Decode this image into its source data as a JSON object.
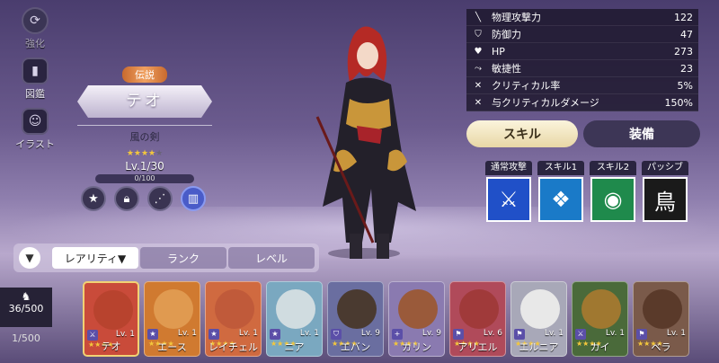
{
  "rail": [
    {
      "label": "強化",
      "icon": "upgrade-icon",
      "disabled": true
    },
    {
      "label": "図鑑",
      "icon": "book-icon",
      "disabled": false
    },
    {
      "label": "イラスト",
      "icon": "portrait-icon",
      "disabled": false
    }
  ],
  "character": {
    "rarity": "伝説",
    "name": "テオ",
    "weapon": "風の剣",
    "level": "Lv.1/30",
    "exp": "0/100",
    "stars_filled": 4
  },
  "stats": [
    {
      "name": "物理攻撃力",
      "value": "122",
      "icon": "sword-icon"
    },
    {
      "name": "防御力",
      "value": "47",
      "icon": "shield-icon"
    },
    {
      "name": "HP",
      "value": "273",
      "icon": "heart-icon"
    },
    {
      "name": "敏捷性",
      "value": "23",
      "icon": "boot-icon"
    },
    {
      "name": "クリティカル率",
      "value": "5%",
      "icon": "crit-icon"
    },
    {
      "name": "与クリティカルダメージ",
      "value": "150%",
      "icon": "crit-damage-icon"
    }
  ],
  "tabs": {
    "skill": "スキル",
    "equip": "装備"
  },
  "skills": [
    {
      "label": "通常攻撃",
      "icon": "normal-attack-icon",
      "bg": "#2050c8",
      "glyph": "⚔"
    },
    {
      "label": "スキル1",
      "icon": "skill1-icon",
      "bg": "#1a7ac8",
      "glyph": "❖"
    },
    {
      "label": "スキル2",
      "icon": "skill2-icon",
      "bg": "#1f8a4c",
      "glyph": "◉"
    },
    {
      "label": "パッシブ",
      "icon": "passive-icon",
      "bg": "#1a1a1a",
      "glyph": "鳥"
    }
  ],
  "sort_tabs": [
    "レアリティ▼",
    "ランク",
    "レベル"
  ],
  "counts": {
    "owned": "36/500",
    "second": "1/500"
  },
  "roster": [
    {
      "name": "テオ",
      "level": "Lv. 1",
      "bg": "#c94b3a",
      "face": "#b8432e",
      "stars": 4,
      "selected": true
    },
    {
      "name": "エース",
      "level": "Lv. 1",
      "bg": "#d07a30",
      "face": "#e09a50",
      "stars": 4,
      "selected": false
    },
    {
      "name": "レイチェル",
      "level": "Lv. 1",
      "bg": "#d06a40",
      "face": "#c05a3a",
      "stars": 4,
      "selected": false
    },
    {
      "name": "ニア",
      "level": "Lv. 1",
      "bg": "#7aa8c0",
      "face": "#d0dce0",
      "stars": 4,
      "selected": false
    },
    {
      "name": "エバン",
      "level": "Lv. 9",
      "bg": "#6a6ea0",
      "face": "#4a3a30",
      "stars": 4,
      "selected": false
    },
    {
      "name": "カリン",
      "level": "Lv. 9",
      "bg": "#8a7ab0",
      "face": "#9a5a3a",
      "stars": 4,
      "selected": false
    },
    {
      "name": "アリエル",
      "level": "Lv. 6",
      "bg": "#b04a5a",
      "face": "#a03a3a",
      "stars": 4,
      "selected": false
    },
    {
      "name": "エルニア",
      "level": "Lv. 1",
      "bg": "#a8a8b8",
      "face": "#e8e8e8",
      "stars": 4,
      "selected": false
    },
    {
      "name": "カイ",
      "level": "Lv. 1",
      "bg": "#4a6a3a",
      "face": "#a07830",
      "stars": 4,
      "selected": false
    },
    {
      "name": "ベラ",
      "level": "Lv. 1",
      "bg": "#7a5a4a",
      "face": "#5a3a2a",
      "stars": 4,
      "selected": false
    }
  ]
}
